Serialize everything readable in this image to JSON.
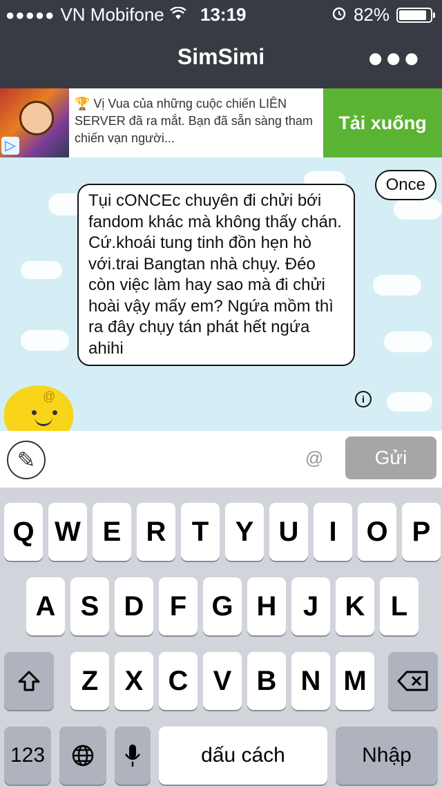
{
  "status": {
    "carrier": "VN Mobifone",
    "time": "13:19",
    "battery": "82%"
  },
  "nav": {
    "title": "SimSimi"
  },
  "ad": {
    "text": "Vị Vua của những cuộc chiến LIÊN SERVER đã ra mắt. Bạn đã sẵn sàng tham chiến vạn người...",
    "download": "Tải xuống"
  },
  "chat": {
    "tag": "Once",
    "message": "Tụi cONCEc chuyên đi chửi bới fandom khác mà không thấy chán. Cứ.khoái tung tinh đồn hẹn hò với.trai Bangtan nhà chụy. Đéo còn việc làm hay sao mà đi chửi hoài vậy mấy em? Ngứa mồm thì ra đây chụy tán phát hết ngứa ahihi"
  },
  "input": {
    "at": "@",
    "send": "Gửi"
  },
  "keyboard": {
    "row1": [
      "Q",
      "W",
      "E",
      "R",
      "T",
      "Y",
      "U",
      "I",
      "O",
      "P"
    ],
    "row2": [
      "A",
      "S",
      "D",
      "F",
      "G",
      "H",
      "J",
      "K",
      "L"
    ],
    "row3": [
      "Z",
      "X",
      "C",
      "V",
      "B",
      "N",
      "M"
    ],
    "num": "123",
    "space": "dấu cách",
    "return": "Nhập"
  },
  "colors": {
    "header": "#383b44",
    "download": "#5ab332",
    "chat_bg": "#d5eef5",
    "send_disabled": "#a6a6a6"
  }
}
